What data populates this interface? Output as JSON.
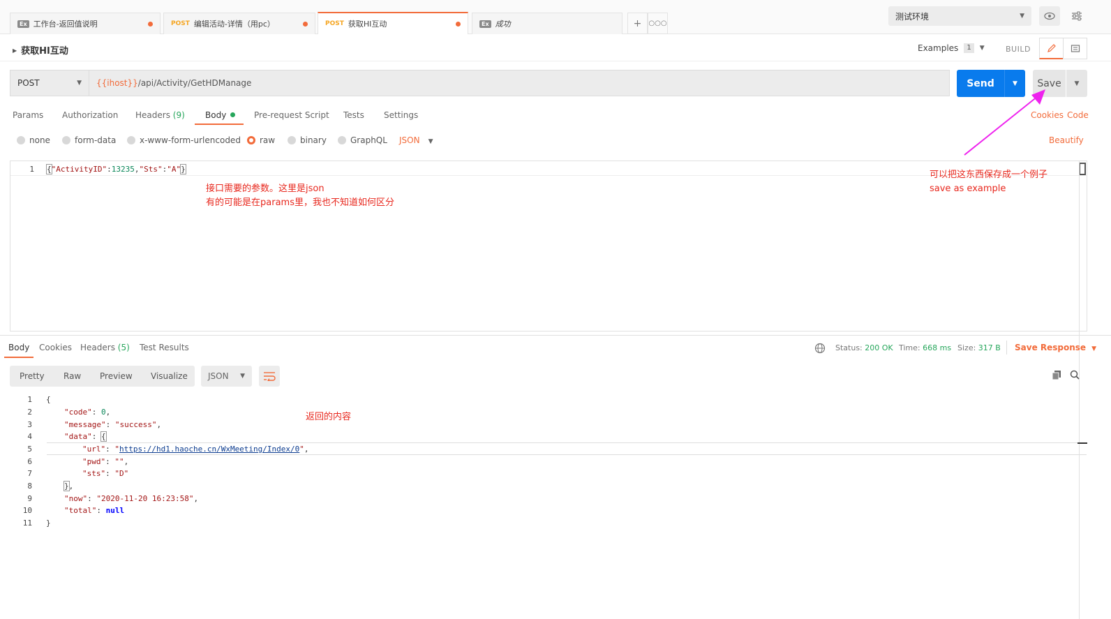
{
  "tabs": [
    {
      "badge": "Ex",
      "method": "",
      "title": "工作台-返回值说明",
      "dirty": true
    },
    {
      "badge": "",
      "method": "POST",
      "title": "编辑活动-详情（用pc）",
      "dirty": true
    },
    {
      "badge": "",
      "method": "POST",
      "title": "获取HI互动",
      "dirty": true,
      "active": true
    },
    {
      "badge": "Ex",
      "method": "",
      "title": "成功",
      "dirty": false
    }
  ],
  "environment": {
    "selected": "测试环境"
  },
  "request": {
    "title": "获取HI互动",
    "examples_label": "Examples",
    "examples_count": "1",
    "build_label": "BUILD",
    "method": "POST",
    "url_var": "{{ihost}}",
    "url_path": "/api/Activity/GetHDManage",
    "send_label": "Send",
    "save_label": "Save"
  },
  "request_tabs": [
    {
      "label": "Params"
    },
    {
      "label": "Authorization"
    },
    {
      "label": "Headers",
      "count": "(9)"
    },
    {
      "label": "Body"
    },
    {
      "label": "Pre-request Script"
    },
    {
      "label": "Tests"
    },
    {
      "label": "Settings"
    }
  ],
  "right_links": {
    "cookies": "Cookies",
    "code": "Code",
    "beautify": "Beautify"
  },
  "body_types": [
    "none",
    "form-data",
    "x-www-form-urlencoded",
    "raw",
    "binary",
    "GraphQL"
  ],
  "body_type_selected": "raw",
  "body_lang": "JSON",
  "request_body": {
    "line_no": "1",
    "open": "{",
    "k1": "\"ActivityID\"",
    "colon": ":",
    "v1": "13235",
    "comma": ",",
    "k2": "\"Sts\"",
    "v2": "\"A\"",
    "close": "}"
  },
  "annotations": {
    "params_line1": "接口需要的参数。这里是json",
    "params_line2": "有的可能是在params里，我也不知道如何区分",
    "save_line1": "可以把这东西保存成一个例子",
    "save_line2": "save as example",
    "response": "返回的内容"
  },
  "response_tabs": [
    {
      "label": "Body"
    },
    {
      "label": "Cookies"
    },
    {
      "label": "Headers",
      "count": "(5)"
    },
    {
      "label": "Test Results"
    }
  ],
  "response_meta": {
    "status_label": "Status:",
    "status": "200 OK",
    "time_label": "Time:",
    "time": "668 ms",
    "size_label": "Size:",
    "size": "317 B",
    "save_response": "Save Response"
  },
  "view_modes": [
    "Pretty",
    "Raw",
    "Preview",
    "Visualize"
  ],
  "response_format": "JSON",
  "response_body": {
    "line_numbers": [
      "1",
      "2",
      "3",
      "4",
      "5",
      "6",
      "7",
      "8",
      "9",
      "10",
      "11"
    ],
    "code_key": "\"code\"",
    "code_val": "0",
    "message_key": "\"message\"",
    "message_val": "\"success\"",
    "data_key": "\"data\"",
    "url_key": "\"url\"",
    "url_val": "https://hd1.haoche.cn/WxMeeting/Index/0",
    "pwd_key": "\"pwd\"",
    "pwd_val": "\"\"",
    "sts_key": "\"sts\"",
    "sts_val": "\"D\"",
    "now_key": "\"now\"",
    "now_val": "\"2020-11-20 16:23:58\"",
    "total_key": "\"total\"",
    "total_val": "null"
  },
  "colors": {
    "accent": "#f26b3a",
    "send": "#097bed",
    "success": "#26a65b",
    "annotation": "#e8281e",
    "arrow": "#ee22ee"
  }
}
